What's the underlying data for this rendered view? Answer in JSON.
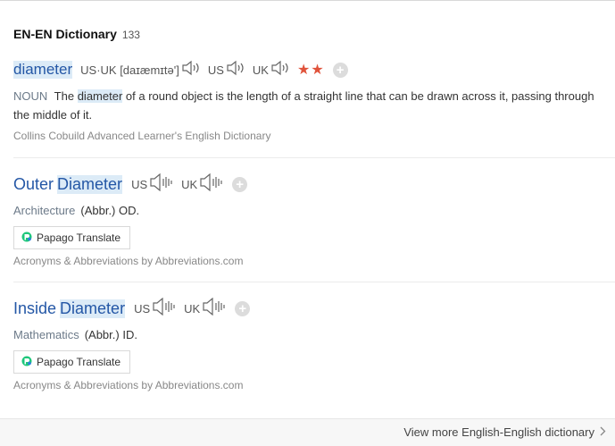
{
  "section": {
    "title": "EN-EN Dictionary",
    "count": "133"
  },
  "entries": [
    {
      "headword": "diameter",
      "pronunciation": "US·UK [daɪæmɪtə']",
      "pron_us": "US",
      "pron_uk": "UK",
      "stars": "★★",
      "pos": "NOUN",
      "def_before": "The",
      "def_highlight": "diameter",
      "def_after": "of a round object is the length of a straight line that can be drawn across it, passing through the middle of it.",
      "source": "Collins Cobuild Advanced Learner's English Dictionary"
    },
    {
      "head_word1": "Outer",
      "head_word2": "Diameter",
      "pron_us": "US",
      "pron_uk": "UK",
      "category": "Architecture",
      "meaning": "(Abbr.) OD.",
      "translate_label": "Papago Translate",
      "source": "Acronyms & Abbreviations by Abbreviations.com"
    },
    {
      "head_word1": "Inside",
      "head_word2": "Diameter",
      "pron_us": "US",
      "pron_uk": "UK",
      "category": "Mathematics",
      "meaning": "(Abbr.) ID.",
      "translate_label": "Papago Translate",
      "source": "Acronyms & Abbreviations by Abbreviations.com"
    }
  ],
  "footer": {
    "more_label": "View more English-English dictionary"
  },
  "icons": {
    "speaker": "speaker-icon",
    "add": "add-icon",
    "papago": "papago-icon",
    "chevron": "chevron-right-icon"
  },
  "colors": {
    "link": "#2457a6",
    "highlight": "#dcebf7",
    "star": "#e0533b"
  }
}
